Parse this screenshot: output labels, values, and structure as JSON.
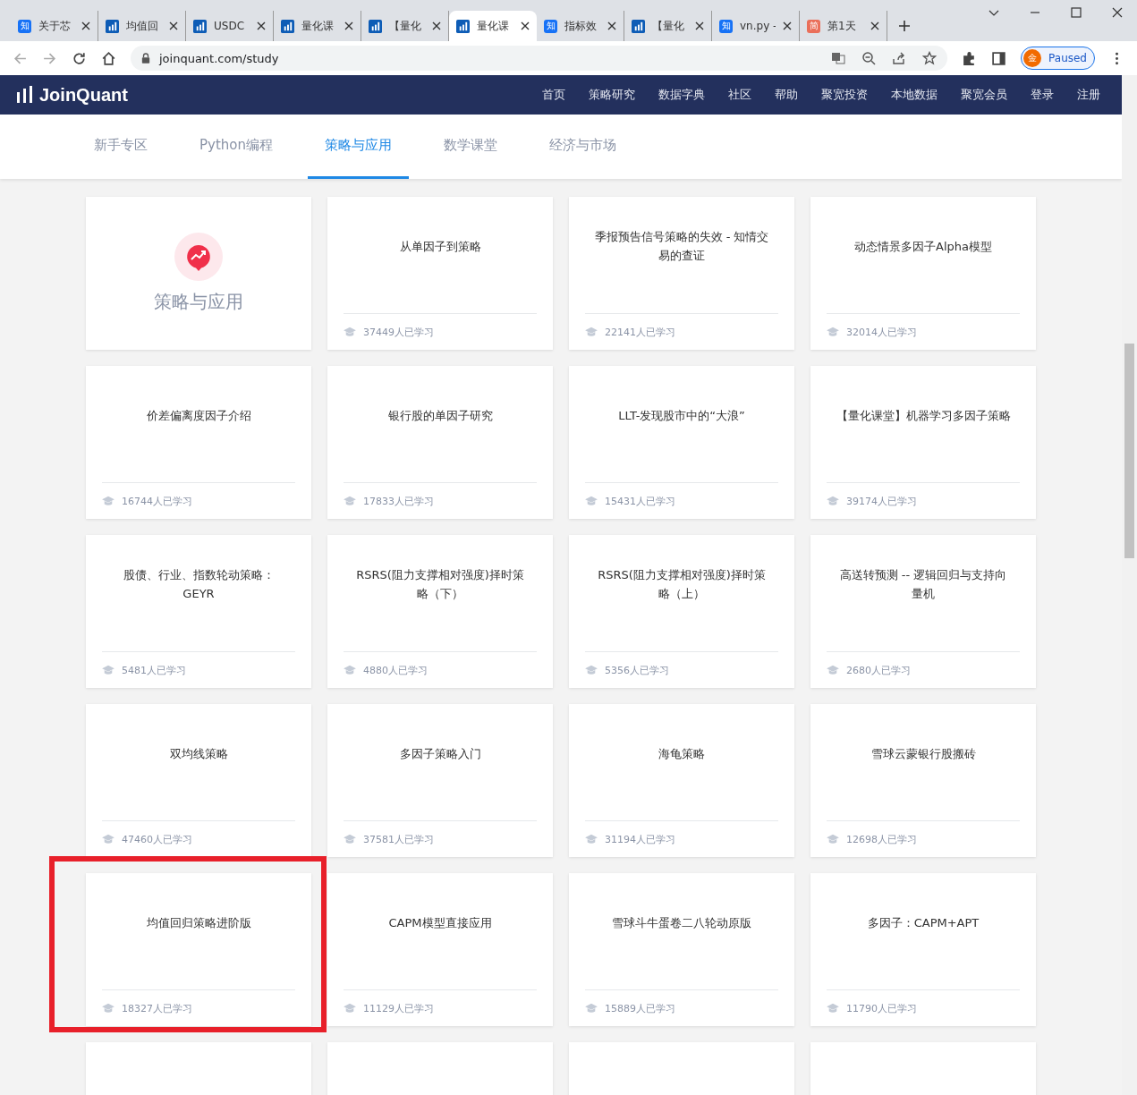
{
  "browser": {
    "tabs": [
      {
        "kind": "zhihu",
        "badge": "知",
        "title": "关于芯",
        "selected": false
      },
      {
        "kind": "joinquant",
        "title": "均值回",
        "selected": false
      },
      {
        "kind": "joinquant",
        "title": "USDC",
        "selected": false
      },
      {
        "kind": "joinquant",
        "title": "量化课",
        "selected": false
      },
      {
        "kind": "joinquant",
        "title": "【量化",
        "selected": false
      },
      {
        "kind": "joinquant",
        "title": "量化课",
        "selected": true
      },
      {
        "kind": "zhihu",
        "badge": "知",
        "title": "指标效",
        "selected": false
      },
      {
        "kind": "joinquant",
        "title": "【量化",
        "selected": false
      },
      {
        "kind": "zhihu",
        "badge": "知",
        "title": "vn.py -",
        "selected": false
      },
      {
        "kind": "jianshu",
        "badge": "简",
        "title": "第1天",
        "selected": false
      }
    ],
    "url": "joinquant.com/study",
    "profile": {
      "avatar": "金",
      "status": "Paused"
    }
  },
  "site": {
    "logo": "JoinQuant",
    "nav": [
      "首页",
      "策略研究",
      "数据字典",
      "社区",
      "帮助",
      "聚宽投资",
      "本地数据",
      "聚宽会员",
      "登录",
      "注册"
    ]
  },
  "sections": [
    {
      "label": "新手专区",
      "selected": false
    },
    {
      "label": "Python编程",
      "selected": false
    },
    {
      "label": "策略与应用",
      "selected": true
    },
    {
      "label": "数学课堂",
      "selected": false
    },
    {
      "label": "经济与市场",
      "selected": false
    }
  ],
  "cards": [
    {
      "kind": "cover",
      "title": "策略与应用"
    },
    {
      "kind": "course",
      "title": "从单因子到策略",
      "learners": "37449人已学习"
    },
    {
      "kind": "course",
      "title": "季报预告信号策略的失效 - 知情交易的查证",
      "learners": "22141人已学习"
    },
    {
      "kind": "course",
      "title": "动态情景多因子Alpha模型",
      "learners": "32014人已学习"
    },
    {
      "kind": "course",
      "title": "价差偏离度因子介绍",
      "learners": "16744人已学习"
    },
    {
      "kind": "course",
      "title": "银行股的单因子研究",
      "learners": "17833人已学习"
    },
    {
      "kind": "course",
      "title": "LLT-发现股市中的“大浪”",
      "learners": "15431人已学习"
    },
    {
      "kind": "course",
      "title": "【量化课堂】机器学习多因子策略",
      "learners": "39174人已学习"
    },
    {
      "kind": "course",
      "title": "股债、行业、指数轮动策略：GEYR",
      "learners": "5481人已学习"
    },
    {
      "kind": "course",
      "title": "RSRS(阻力支撑相对强度)择时策略（下）",
      "learners": "4880人已学习"
    },
    {
      "kind": "course",
      "title": "RSRS(阻力支撑相对强度)择时策略（上）",
      "learners": "5356人已学习"
    },
    {
      "kind": "course",
      "title": "高送转预测 -- 逻辑回归与支持向量机",
      "learners": "2680人已学习"
    },
    {
      "kind": "course",
      "title": "双均线策略",
      "learners": "47460人已学习"
    },
    {
      "kind": "course",
      "title": "多因子策略入门",
      "learners": "37581人已学习"
    },
    {
      "kind": "course",
      "title": "海龟策略",
      "learners": "31194人已学习"
    },
    {
      "kind": "course",
      "title": "雪球云蒙银行股搬砖",
      "learners": "12698人已学习"
    },
    {
      "kind": "course",
      "title": "均值回归策略进阶版",
      "learners": "18327人已学习",
      "highlighted": true
    },
    {
      "kind": "course",
      "title": "CAPM模型直接应用",
      "learners": "11129人已学习"
    },
    {
      "kind": "course",
      "title": "雪球斗牛蛋卷二八轮动原版",
      "learners": "15889人已学习"
    },
    {
      "kind": "course",
      "title": "多因子：CAPM+APT",
      "learners": "11790人已学习"
    },
    {
      "kind": "blank"
    },
    {
      "kind": "blank"
    },
    {
      "kind": "blank"
    },
    {
      "kind": "blank"
    }
  ]
}
